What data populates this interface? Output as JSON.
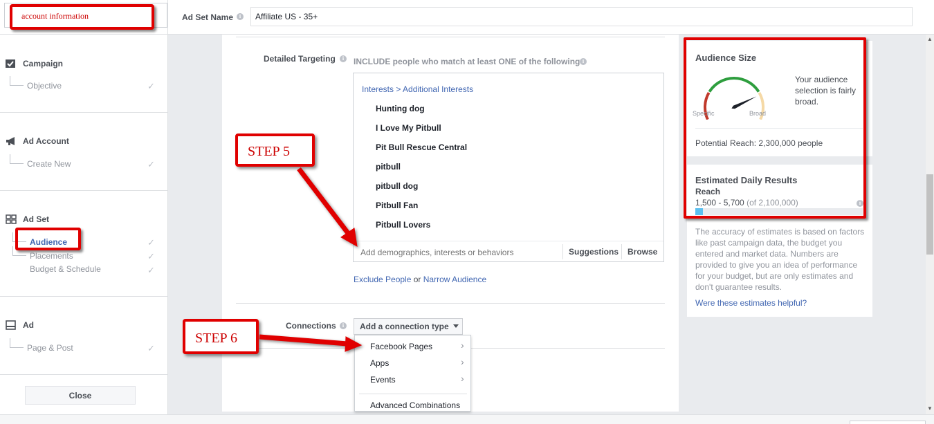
{
  "header": {
    "account_label": "account information",
    "adset_name_label": "Ad Set Name",
    "adset_name_value": "Affiliate US - 35+"
  },
  "sidebar": {
    "sections": [
      {
        "title": "Campaign",
        "icon": "checkbox-icon",
        "items": [
          {
            "label": "Objective",
            "checked": true
          }
        ]
      },
      {
        "title": "Ad Account",
        "icon": "megaphone-icon",
        "items": [
          {
            "label": "Create New",
            "checked": true
          }
        ]
      },
      {
        "title": "Ad Set",
        "icon": "grid-icon",
        "items": [
          {
            "label": "Audience",
            "checked": true,
            "active": true
          },
          {
            "label": "Placements",
            "checked": true
          },
          {
            "label": "Budget & Schedule",
            "checked": true
          }
        ]
      },
      {
        "title": "Ad",
        "icon": "ad-box-icon",
        "items": [
          {
            "label": "Page & Post",
            "checked": true
          }
        ]
      }
    ],
    "close_label": "Close",
    "check_glyph": "✓"
  },
  "targeting": {
    "label": "Detailed Targeting",
    "include_text": "INCLUDE people who match at least ONE of the following",
    "breadcrumb": "Interests > Additional Interests",
    "interests": [
      "Hunting dog",
      "I Love My Pitbull",
      "Pit Bull Rescue Central",
      "pitbull",
      "pitbull dog",
      "Pitbull Fan",
      "Pitbull Lovers"
    ],
    "input_placeholder": "Add demographics, interests or behaviors",
    "suggestions_label": "Suggestions",
    "browse_label": "Browse",
    "exclude_link": "Exclude People",
    "or_text": "or",
    "narrow_link": "Narrow Audience"
  },
  "connections": {
    "label": "Connections",
    "button_label": "Add a connection type",
    "menu": [
      "Facebook Pages",
      "Apps",
      "Events",
      "Advanced Combinations"
    ],
    "chevron_glyph": "›"
  },
  "audience_size": {
    "title": "Audience Size",
    "specific_label": "Specific",
    "broad_label": "Broad",
    "description": "Your audience selection is fairly broad.",
    "potential_reach": "Potential Reach: 2,300,000 people",
    "gauge_level": 0.78,
    "colors": {
      "specific": "#c0392b",
      "middle": "#2e9e3e",
      "broad": "#f5d9a6"
    }
  },
  "estimated": {
    "title": "Estimated Daily Results",
    "subtitle": "Reach",
    "range": "1,500 - 5,700",
    "range_total": "(of 2,100,000)",
    "bar_fraction": 0.045,
    "note": "The accuracy of estimates is based on factors like past campaign data, the budget you entered and market data. Numbers are provided to give you an idea of performance for your budget, but are only estimates and don't guarantee results.",
    "helpful_link": "Were these estimates helpful?"
  },
  "annotations": {
    "step5": "STEP 5",
    "step6": "STEP 6",
    "color": "#e00000"
  },
  "scrollbar": {
    "up_glyph": "▲",
    "down_glyph": "▼"
  }
}
